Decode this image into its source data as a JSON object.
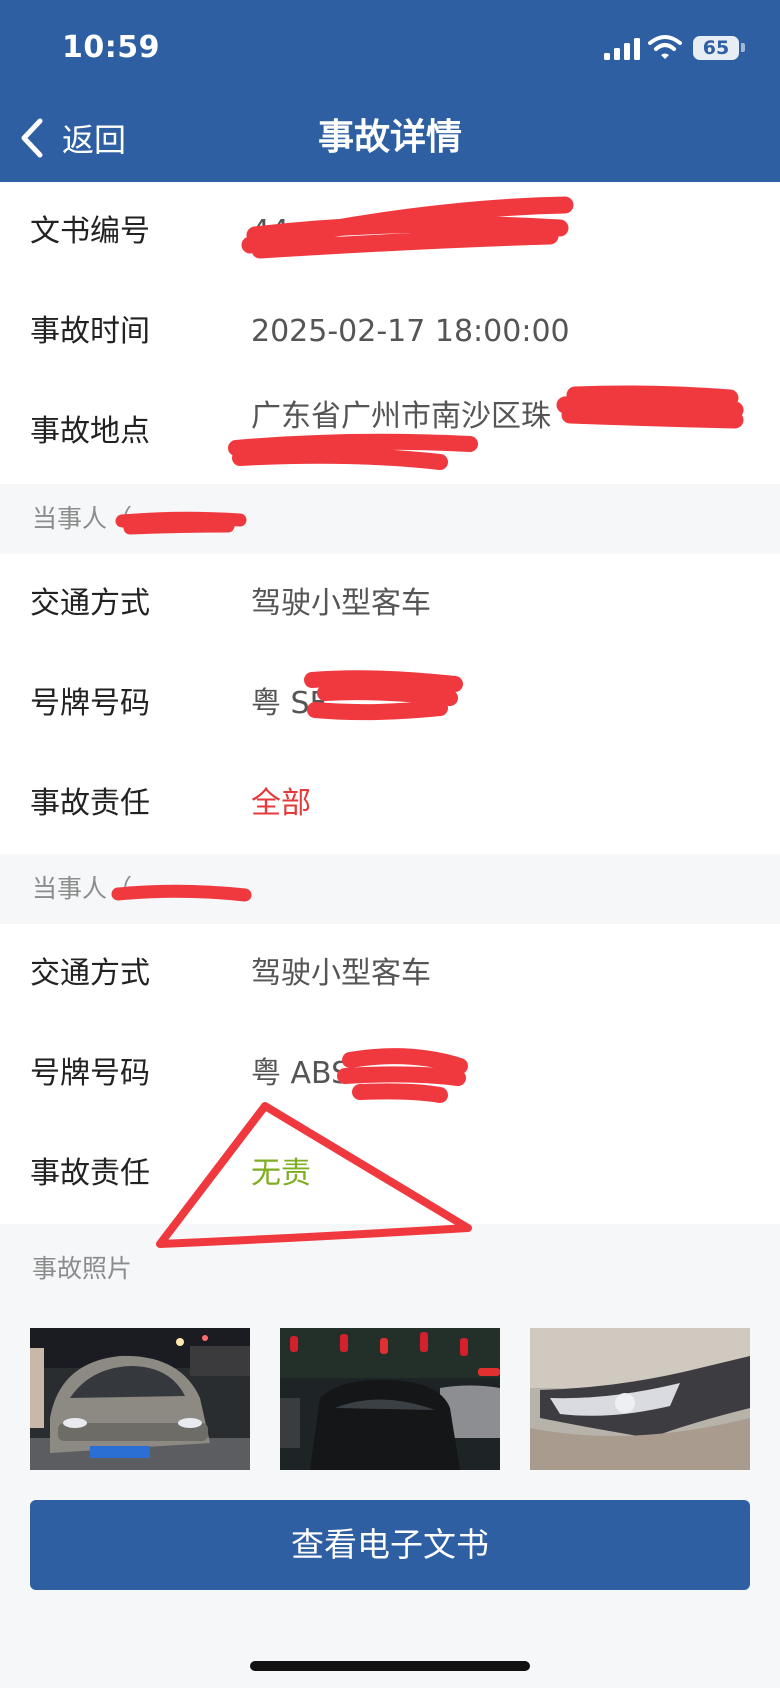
{
  "status": {
    "time": "10:59",
    "battery": "65"
  },
  "nav": {
    "back_label": "返回",
    "title": "事故详情"
  },
  "info": {
    "doc_no_label": "文书编号",
    "doc_no_value": "44",
    "time_label": "事故时间",
    "time_value": "2025-02-17 18:00:00",
    "place_label": "事故地点",
    "place_value": "广东省广州市南沙区珠"
  },
  "party1": {
    "header": "当事人（",
    "transport_label": "交通方式",
    "transport_value": "驾驶小型客车",
    "plate_label": "号牌号码",
    "plate_value": "粤 SF",
    "liability_label": "事故责任",
    "liability_value": "全部"
  },
  "party2": {
    "header": "当事人（",
    "transport_label": "交通方式",
    "transport_value": "驾驶小型客车",
    "plate_label": "号牌号码",
    "plate_value": "粤 ABS",
    "liability_label": "事故责任",
    "liability_value": "无责"
  },
  "photos": {
    "header": "事故照片"
  },
  "action": {
    "view_doc": "查看电子文书"
  },
  "colors": {
    "brand": "#2e5fa3",
    "liability_full": "#e5393b",
    "liability_none": "#7fae22",
    "redaction": "#f0393f"
  }
}
